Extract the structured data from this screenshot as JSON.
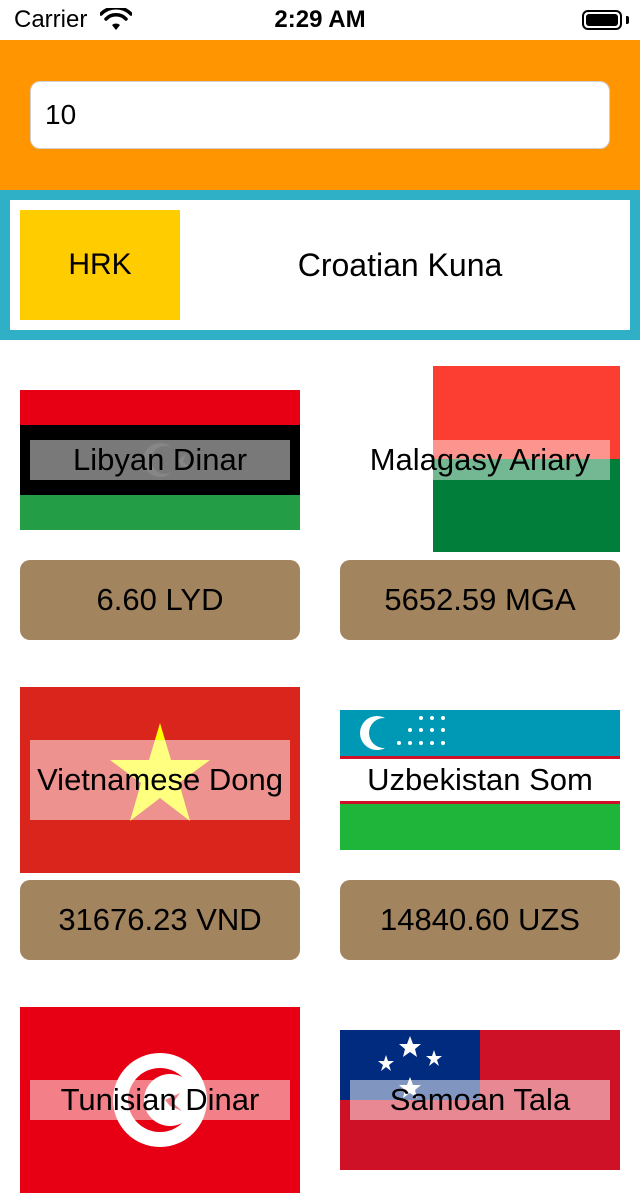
{
  "status_bar": {
    "carrier": "Carrier",
    "time": "2:29 AM"
  },
  "header": {
    "amount_value": "10",
    "background_color": "#ff9500"
  },
  "base_currency": {
    "code": "HRK",
    "name": "Croatian Kuna",
    "border_color": "#30b0c7",
    "code_color": "#ffcc00"
  },
  "conversions": [
    {
      "name": "Libyan Dinar",
      "value": "6.60 LYD",
      "flag": "libya-flag-icon"
    },
    {
      "name": "Malagasy Ariary",
      "value": "5652.59 MGA",
      "flag": "madagascar-flag-icon"
    },
    {
      "name": "Vietnamese Dong",
      "value": "31676.23 VND",
      "flag": "vietnam-flag-icon"
    },
    {
      "name": "Uzbekistan Som",
      "value": "14840.60 UZS",
      "flag": "uzbekistan-flag-icon"
    },
    {
      "name": "Tunisian Dinar",
      "value": "",
      "flag": "tunisia-flag-icon"
    },
    {
      "name": "Samoan Tala",
      "value": "",
      "flag": "samoa-flag-icon"
    }
  ],
  "colors": {
    "value_box": "#a2845e"
  }
}
